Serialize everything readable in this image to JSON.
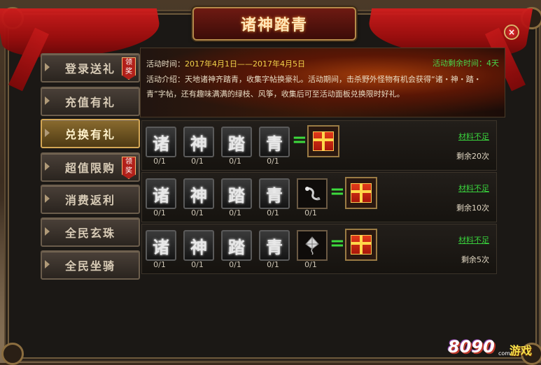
{
  "window": {
    "title": "诸神踏青",
    "close_label": "×"
  },
  "sidebar": {
    "items": [
      {
        "label": "登录送礼",
        "claim": "领奖"
      },
      {
        "label": "充值有礼",
        "claim": ""
      },
      {
        "label": "兑换有礼",
        "claim": ""
      },
      {
        "label": "超值限购",
        "claim": "领奖"
      },
      {
        "label": "消费返利",
        "claim": ""
      },
      {
        "label": "全民玄珠",
        "claim": ""
      },
      {
        "label": "全民坐骑",
        "claim": ""
      }
    ],
    "active_index": 2
  },
  "banner": {
    "time_label": "活动时间：",
    "time_value": "2017年4月1日——2017年4月5日",
    "remain_label": "活动剩余时间：",
    "remain_value": "4天",
    "desc": "活动介绍：天地诸神齐踏青，收集字帖换豪礼。活动期间，击杀野外怪物有机会获得“诸・神・踏・青”字帖，还有趣味满满的绿枝、风筝，收集后可至活动面板兑换限时好礼。"
  },
  "exchange_rows": [
    {
      "chars": [
        "诸",
        "神",
        "踏",
        "青"
      ],
      "counts": [
        "0/1",
        "0/1",
        "0/1",
        "0/1"
      ],
      "extra_item": "",
      "extra_count": "",
      "equals": "=",
      "reward_icon": "gift-box-icon",
      "status": "材料不足",
      "remaining": "剩余20次"
    },
    {
      "chars": [
        "诸",
        "神",
        "踏",
        "青"
      ],
      "counts": [
        "0/1",
        "0/1",
        "0/1",
        "0/1"
      ],
      "extra_item": "green-branch-icon",
      "extra_count": "0/1",
      "equals": "=",
      "reward_icon": "gift-box-icon",
      "status": "材料不足",
      "remaining": "剩余10次"
    },
    {
      "chars": [
        "诸",
        "神",
        "踏",
        "青"
      ],
      "counts": [
        "0/1",
        "0/1",
        "0/1",
        "0/1"
      ],
      "extra_item": "kite-icon",
      "extra_count": "0/1",
      "equals": "=",
      "reward_icon": "gift-box-icon",
      "status": "材料不足",
      "remaining": "剩余5次"
    }
  ],
  "logo": {
    "number": "8090",
    "name": "游戏",
    "domain": "com"
  },
  "colors": {
    "accent_green": "#39d23c",
    "date_yellow": "#f2d24a",
    "ribbon_red": "#c01818"
  }
}
